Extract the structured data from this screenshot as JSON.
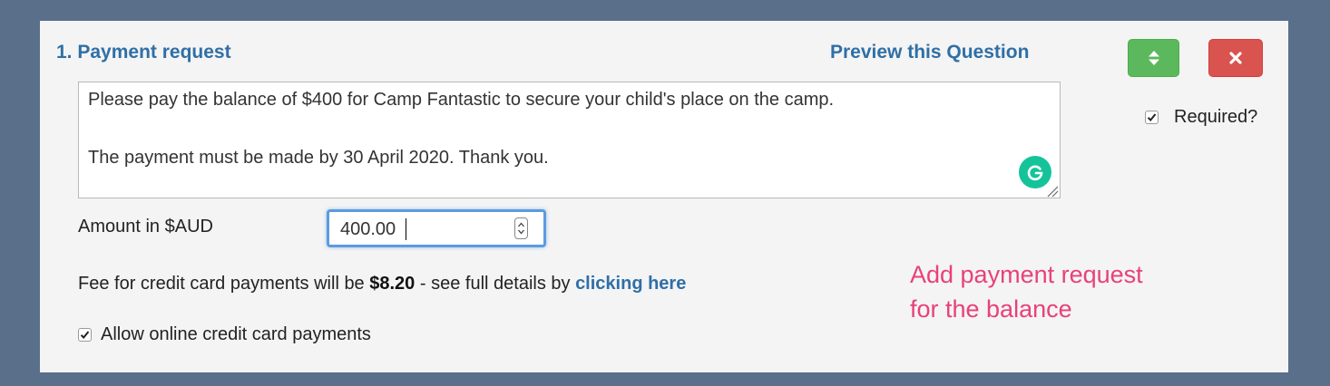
{
  "question": {
    "title": "1. Payment request",
    "preview_link": "Preview this Question",
    "required_label": "Required?",
    "required_checked": true,
    "description_line1": "Please pay the balance of $400 for Camp Fantastic to secure your child's place on the camp.",
    "description_line2": "The payment must be made by 30 April 2020. Thank you."
  },
  "buttons": {
    "move_icon": "sort-updown-icon",
    "delete_icon": "close-icon"
  },
  "amount": {
    "label": "Amount in $AUD",
    "value": "400.00"
  },
  "fee": {
    "prefix": "Fee for credit card payments will be ",
    "amount": "$8.20",
    "middle": " - see full details by ",
    "link": "clicking here"
  },
  "online_payments": {
    "label": "Allow online credit card payments",
    "checked": true
  },
  "annotation": {
    "line1": "Add payment request",
    "line2": "for the balance"
  },
  "colors": {
    "background": "#5a6f8a",
    "link": "#2f6fa6",
    "success": "#5cb85c",
    "danger": "#d9534f",
    "annotation": "#e8417a",
    "grammarly": "#15c39a"
  }
}
